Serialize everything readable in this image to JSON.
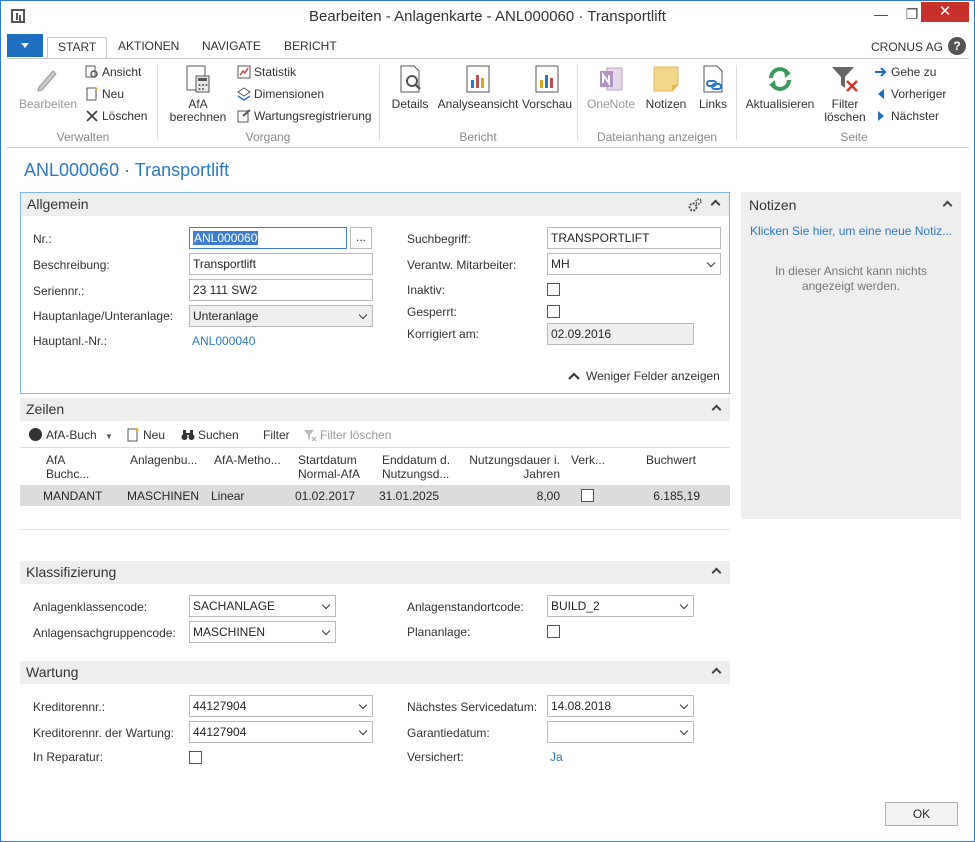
{
  "window": {
    "title": "Bearbeiten - Anlagenkarte - ANL000060 · Transportlift",
    "minimize": "—",
    "maximize": "❐",
    "close": "✕"
  },
  "ribbon_tabs": [
    "START",
    "AKTIONEN",
    "NAVIGATE",
    "BERICHT"
  ],
  "company": "CRONUS AG",
  "help": "?",
  "ribbon": {
    "verwalten": {
      "label": "Verwalten",
      "bearbeiten": "Bearbeiten",
      "ansicht": "Ansicht",
      "neu": "Neu",
      "loeschen": "Löschen"
    },
    "vorgang": {
      "label": "Vorgang",
      "afa_berechnen_1": "AfA",
      "afa_berechnen_2": "berechnen",
      "statistik": "Statistik",
      "dimensionen": "Dimensionen",
      "wartungsregistrierung": "Wartungsregistrierung"
    },
    "bericht": {
      "label": "Bericht",
      "details": "Details",
      "analyseansicht": "Analyseansicht",
      "vorschau": "Vorschau"
    },
    "dateianhang": {
      "label": "Dateianhang anzeigen",
      "onenote": "OneNote",
      "notizen": "Notizen",
      "links": "Links"
    },
    "seite": {
      "label": "Seite",
      "aktualisieren": "Aktualisieren",
      "filter_loeschen_1": "Filter",
      "filter_loeschen_2": "löschen",
      "gehe_zu": "Gehe zu",
      "vorheriger": "Vorheriger",
      "naechster": "Nächster"
    }
  },
  "page_title": "ANL000060 · Transportlift",
  "allgemein": {
    "header": "Allgemein",
    "nr_label": "Nr.:",
    "nr_value": "ANL000060",
    "dots": "...",
    "beschreibung_label": "Beschreibung:",
    "beschreibung_value": "Transportlift",
    "seriennr_label": "Seriennr.:",
    "seriennr_value": "23 111 SW2",
    "haupt_unter_label": "Hauptanlage/Unteranlage:",
    "haupt_unter_value": "Unteranlage",
    "hauptanl_nr_label": "Hauptanl.-Nr.:",
    "hauptanl_nr_value": "ANL000040",
    "suchbegriff_label": "Suchbegriff:",
    "suchbegriff_value": "TRANSPORTLIFT",
    "mitarbeiter_label": "Verantw. Mitarbeiter:",
    "mitarbeiter_value": "MH",
    "inaktiv_label": "Inaktiv:",
    "gesperrt_label": "Gesperrt:",
    "korrigiert_label": "Korrigiert am:",
    "korrigiert_value": "02.09.2016",
    "weniger_felder": "Weniger Felder anzeigen"
  },
  "zeilen": {
    "header": "Zeilen",
    "toolbar": {
      "afa_buch": "AfA-Buch",
      "neu": "Neu",
      "suchen": "Suchen",
      "filter": "Filter",
      "filter_loeschen": "Filter löschen"
    },
    "columns": [
      [
        "AfA",
        "Buchc..."
      ],
      [
        "Anlagenbu...",
        ""
      ],
      [
        "AfA-Metho...",
        ""
      ],
      [
        "Startdatum",
        "Normal-AfA"
      ],
      [
        "Enddatum d.",
        "Nutzungsd..."
      ],
      [
        "Nutzungsdauer i.",
        "Jahren"
      ],
      [
        "Verk...",
        ""
      ],
      [
        "Buchwert",
        ""
      ]
    ],
    "rows": [
      {
        "buch": "MANDANT",
        "anlagenbuch": "MASCHINEN",
        "methode": "Linear",
        "start": "01.02.2017",
        "ende": "31.01.2025",
        "dauer": "8,00",
        "verkauft": false,
        "buchwert": "6.185,19"
      }
    ]
  },
  "klassifizierung": {
    "header": "Klassifizierung",
    "klassencode_label": "Anlagenklassencode:",
    "klassencode_value": "SACHANLAGE",
    "sachgruppe_label": "Anlagensachgruppencode:",
    "sachgruppe_value": "MASCHINEN",
    "standort_label": "Anlagenstandortcode:",
    "standort_value": "BUILD_2",
    "planlage_label": "Plananlage:"
  },
  "wartung": {
    "header": "Wartung",
    "kreditor_label": "Kreditorennr.:",
    "kreditor_value": "44127904",
    "kreditor_wartung_label": "Kreditorennr. der Wartung:",
    "kreditor_wartung_value": "44127904",
    "reparatur_label": "In Reparatur:",
    "service_label": "Nächstes Servicedatum:",
    "service_value": "14.08.2018",
    "garantie_label": "Garantiedatum:",
    "garantie_value": "",
    "versichert_label": "Versichert:",
    "versichert_value": "Ja"
  },
  "notizen": {
    "title": "Notizen",
    "link": "Klicken Sie hier, um eine neue Notiz...",
    "info": "In dieser Ansicht kann nichts angezeigt werden."
  },
  "ok": "OK",
  "colors": {
    "accent": "#2a7ac1",
    "menu_blue": "#1e6fbf",
    "close_red": "#c7302b",
    "section_bg": "#eeeeee"
  }
}
